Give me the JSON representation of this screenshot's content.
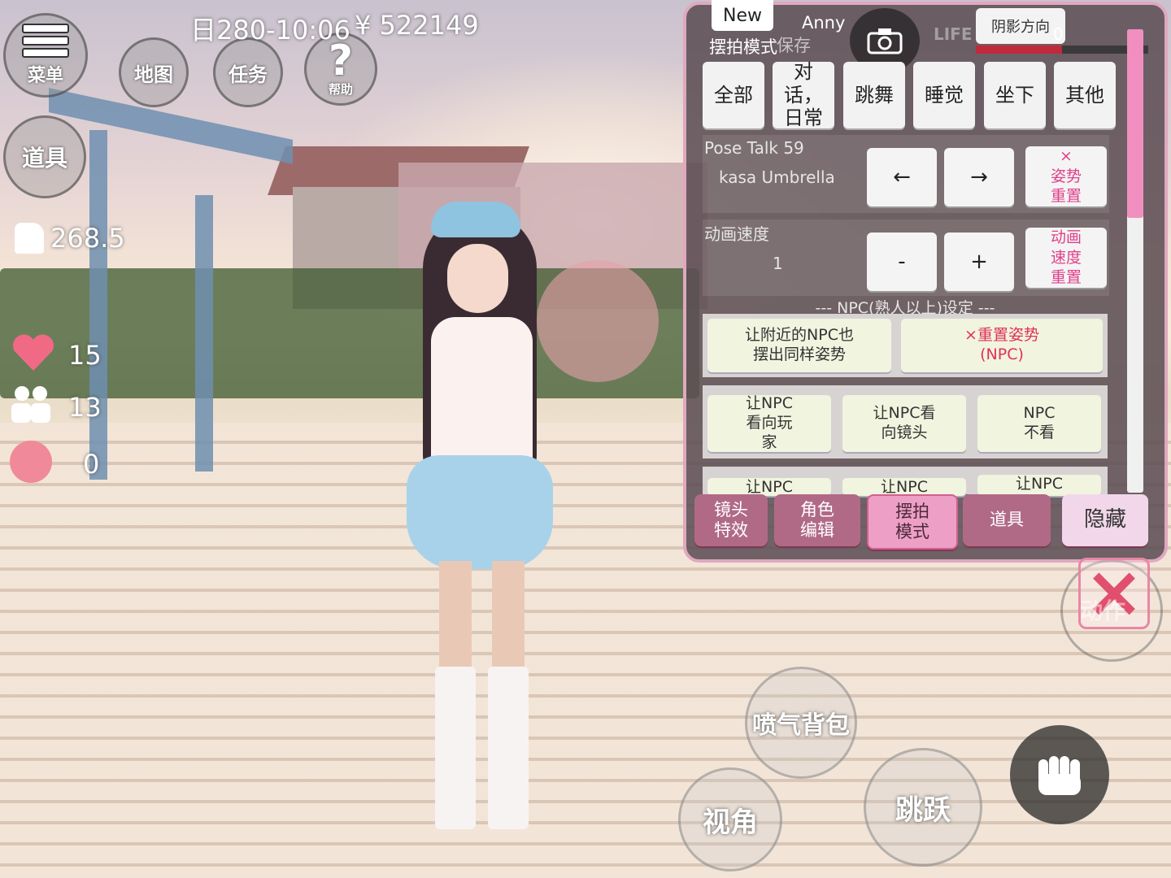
{
  "hud": {
    "menu_label": "菜单",
    "map_label": "地图",
    "task_label": "任务",
    "help_symbol": "?",
    "help_label": "帮助",
    "items_label": "道具",
    "datetime": "日280-10:06",
    "currency": "¥ 522149",
    "stamina": "268.5",
    "hearts": "15",
    "friends": "13",
    "anger": "0"
  },
  "panel": {
    "new_tab": "New",
    "title": "摆拍模式",
    "save_label": "保存",
    "user_name": "Anny",
    "life_logo": "LIFE",
    "shadow_label": "阴影方向",
    "shadow_value": "0",
    "shadow_level": 0.5,
    "scroll_position": 0.0,
    "categories": [
      {
        "label": "全部"
      },
      {
        "label": "对话，日常"
      },
      {
        "label": "跳舞"
      },
      {
        "label": "睡觉"
      },
      {
        "label": "坐下"
      },
      {
        "label": "其他"
      }
    ],
    "pose_label": "Pose Talk 59",
    "pose_name": "kasa Umbrella",
    "prev_arrow": "←",
    "next_arrow": "→",
    "pose_reset_x": "×",
    "pose_reset_label": "姿势重置",
    "speed_label": "动画速度",
    "speed_value": "1",
    "speed_minus": "-",
    "speed_plus": "+",
    "speed_reset_label": "动画速度重置",
    "npc_header": "--- NPC(熟人以上)设定 ---",
    "npc_same_pose": "让附近的NPC也摆出同样姿势",
    "npc_reset_pose": "×重置姿势(NPC)",
    "npc_look_player": "让NPC看向玩家",
    "npc_look_camera": "让NPC看向镜头",
    "npc_no_look": "NPC不看",
    "npc_partial_1": "让NPC",
    "npc_partial_2": "让NPC",
    "npc_partial_3": "让NPC",
    "tabs": [
      {
        "label": "镜头特效"
      },
      {
        "label": "角色编辑"
      },
      {
        "label": "摆拍模式"
      },
      {
        "label": "道具"
      },
      {
        "label": "隐藏"
      }
    ]
  },
  "actions": {
    "close_symbol": "×",
    "jetpack": "喷气背包",
    "view": "视角",
    "jump": "跳跃",
    "action": "动作"
  },
  "colors": {
    "panel_border": "#e0a8bf",
    "accent_pink": "#e0408a",
    "active_tab": "#ee9fc5"
  }
}
